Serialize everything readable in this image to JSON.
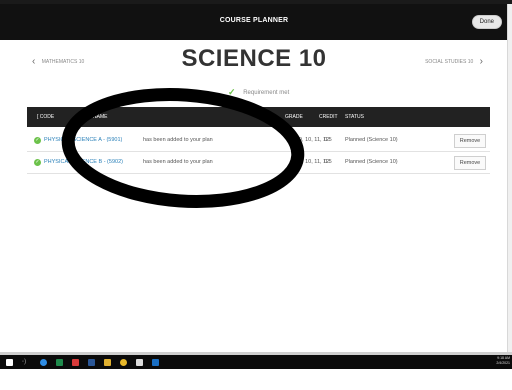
{
  "header": {
    "app_title": "COURSE PLANNER",
    "done_label": "Done"
  },
  "nav": {
    "prev_label": "MATHEMATICS 10",
    "next_label": "SOCIAL STUDIES 10",
    "page_title": "SCIENCE 10",
    "requirement_text": "Requirement met"
  },
  "table": {
    "headers": {
      "code": "[ CODE",
      "name": "NAME",
      "grade": "GRADE",
      "credit": "CREDIT",
      "status": "STATUS"
    },
    "rows": [
      {
        "course": "PHYSICAL SCIENCE A - (5901)",
        "added_text": "has been added to your plan",
        "grade": "9, 10, 11, 12",
        "credit": "0.5",
        "status": "Planned (Science 10)",
        "remove_label": "Remove"
      },
      {
        "course": "PHYSICAL SCIENCE B - (5902)",
        "added_text": "has been added to your plan",
        "grade": "9, 10, 11, 12",
        "credit": "0.5",
        "status": "Planned (Science 10)",
        "remove_label": "Remove"
      }
    ]
  },
  "taskbar": {
    "time": "9:18 AM",
    "date": "2/4/2021"
  },
  "colors": {
    "accent_green": "#6cc24a",
    "link_blue": "#2a80b9",
    "header_dark": "#111111"
  }
}
